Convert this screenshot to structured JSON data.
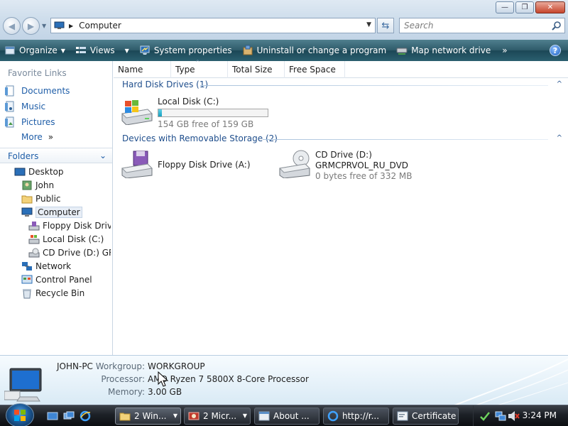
{
  "window": {
    "controls": {
      "minimize": "—",
      "maximize": "❐",
      "close": "✕"
    }
  },
  "address_bar": {
    "crumb": "Computer",
    "search_placeholder": "Search"
  },
  "command_bar": {
    "organize": "Organize",
    "views": "Views",
    "system_properties": "System properties",
    "uninstall": "Uninstall or change a program",
    "map_drive": "Map network drive",
    "more": "»",
    "help": "?"
  },
  "left_pane": {
    "favorite_links_title": "Favorite Links",
    "favorites": [
      "Documents",
      "Music",
      "Pictures"
    ],
    "more_label": "More",
    "more_glyph": "»",
    "folders_title": "Folders",
    "tree": [
      "Desktop",
      "John",
      "Public",
      "Computer",
      "Floppy Disk Drive",
      "Local Disk (C:)",
      "CD Drive (D:) GRM",
      "Network",
      "Control Panel",
      "Recycle Bin"
    ]
  },
  "columns": [
    "Name",
    "Type",
    "Total Size",
    "Free Space"
  ],
  "groups": {
    "hard_disk": {
      "header": "Hard Disk Drives (1)",
      "drives": [
        {
          "name": "Local Disk (C:)",
          "free_text": "154 GB free of 159 GB",
          "used_fraction": 0.03,
          "icon": "windows-drive-icon"
        }
      ]
    },
    "removable": {
      "header": "Devices with Removable Storage (2)",
      "drives": [
        {
          "name": "Floppy Disk Drive (A:)",
          "icon": "floppy-drive-icon"
        },
        {
          "name": "CD Drive (D:)",
          "label": "GRMCPRVOL_RU_DVD",
          "free_text": "0 bytes free of 332 MB",
          "icon": "cd-drive-icon"
        }
      ]
    }
  },
  "details": {
    "computer_name": "JOHN-PC",
    "workgroup_label": "Workgroup:",
    "workgroup": "WORKGROUP",
    "processor_label": "Processor:",
    "processor": "AMD Ryzen 7 5800X 8-Core Processor",
    "memory_label": "Memory:",
    "memory": "3.00 GB"
  },
  "taskbar": {
    "tasks": [
      "2 Win...",
      "2 Micr...",
      "About ...",
      "http://r...",
      "Certificate"
    ],
    "clock": "3:24 PM"
  },
  "colors": {
    "command_bar": "#2e5a69",
    "link_blue": "#1f5ea8",
    "group_blue": "#1f4e8c"
  }
}
